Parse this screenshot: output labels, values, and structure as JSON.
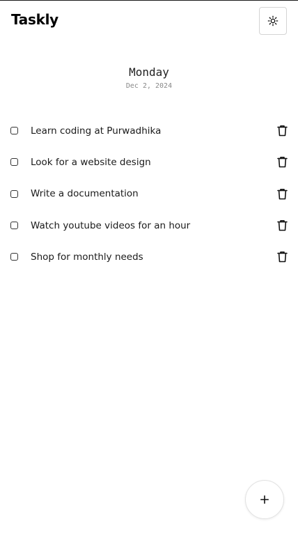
{
  "header": {
    "app_title": "Taskly",
    "theme_icon": "sun-icon"
  },
  "day": {
    "name": "Monday",
    "date": "Dec 2, 2024"
  },
  "tasks": [
    {
      "label": "Learn coding at Purwadhika",
      "done": false
    },
    {
      "label": "Look for a website design",
      "done": false
    },
    {
      "label": "Write a documentation",
      "done": false
    },
    {
      "label": "Watch youtube videos for an hour",
      "done": false
    },
    {
      "label": "Shop for monthly needs",
      "done": false
    }
  ],
  "icons": {
    "delete": "trash-icon",
    "add": "plus-icon"
  }
}
